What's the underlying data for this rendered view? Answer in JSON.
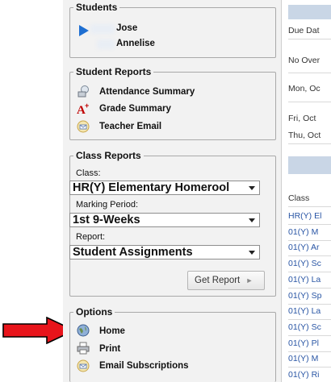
{
  "students": {
    "legend": "Students",
    "items": [
      {
        "name": "Jose"
      },
      {
        "name": "Annelise"
      }
    ]
  },
  "student_reports": {
    "legend": "Student Reports",
    "items": [
      {
        "label": "Attendance Summary",
        "icon": "attendance-icon"
      },
      {
        "label": "Grade Summary",
        "icon": "grade-icon"
      },
      {
        "label": "Teacher Email",
        "icon": "email-icon"
      }
    ]
  },
  "class_reports": {
    "legend": "Class Reports",
    "class_label": "Class:",
    "class_value": "HR(Y) Elementary Homerool",
    "period_label": "Marking Period:",
    "period_value": "1st 9-Weeks",
    "report_label": "Report:",
    "report_value": "Student Assignments",
    "get_report_label": "Get Report"
  },
  "options": {
    "legend": "Options",
    "items": [
      {
        "label": "Home",
        "icon": "globe-icon"
      },
      {
        "label": "Print",
        "icon": "printer-icon"
      },
      {
        "label": "Email Subscriptions",
        "icon": "email-icon"
      }
    ]
  },
  "right_pane": {
    "header": "Due Dat",
    "rows": [
      "No Over",
      "Mon, Oc",
      "Fri, Oct",
      "Thu, Oct"
    ],
    "class_header": "Class",
    "class_rows": [
      "HR(Y) El",
      "01(Y) M",
      "01(Y) Ar",
      "01(Y) Sc",
      "01(Y) La",
      "01(Y) Sp",
      "01(Y) La",
      "01(Y) Sc",
      "01(Y) Pl",
      "01(Y) M",
      "01(Y) Ri"
    ]
  },
  "colors": {
    "arrow": "#e8141b",
    "link": "#2a56a5",
    "panel_bg": "#f2f2f2",
    "play_icon": "#1f6fd1"
  }
}
